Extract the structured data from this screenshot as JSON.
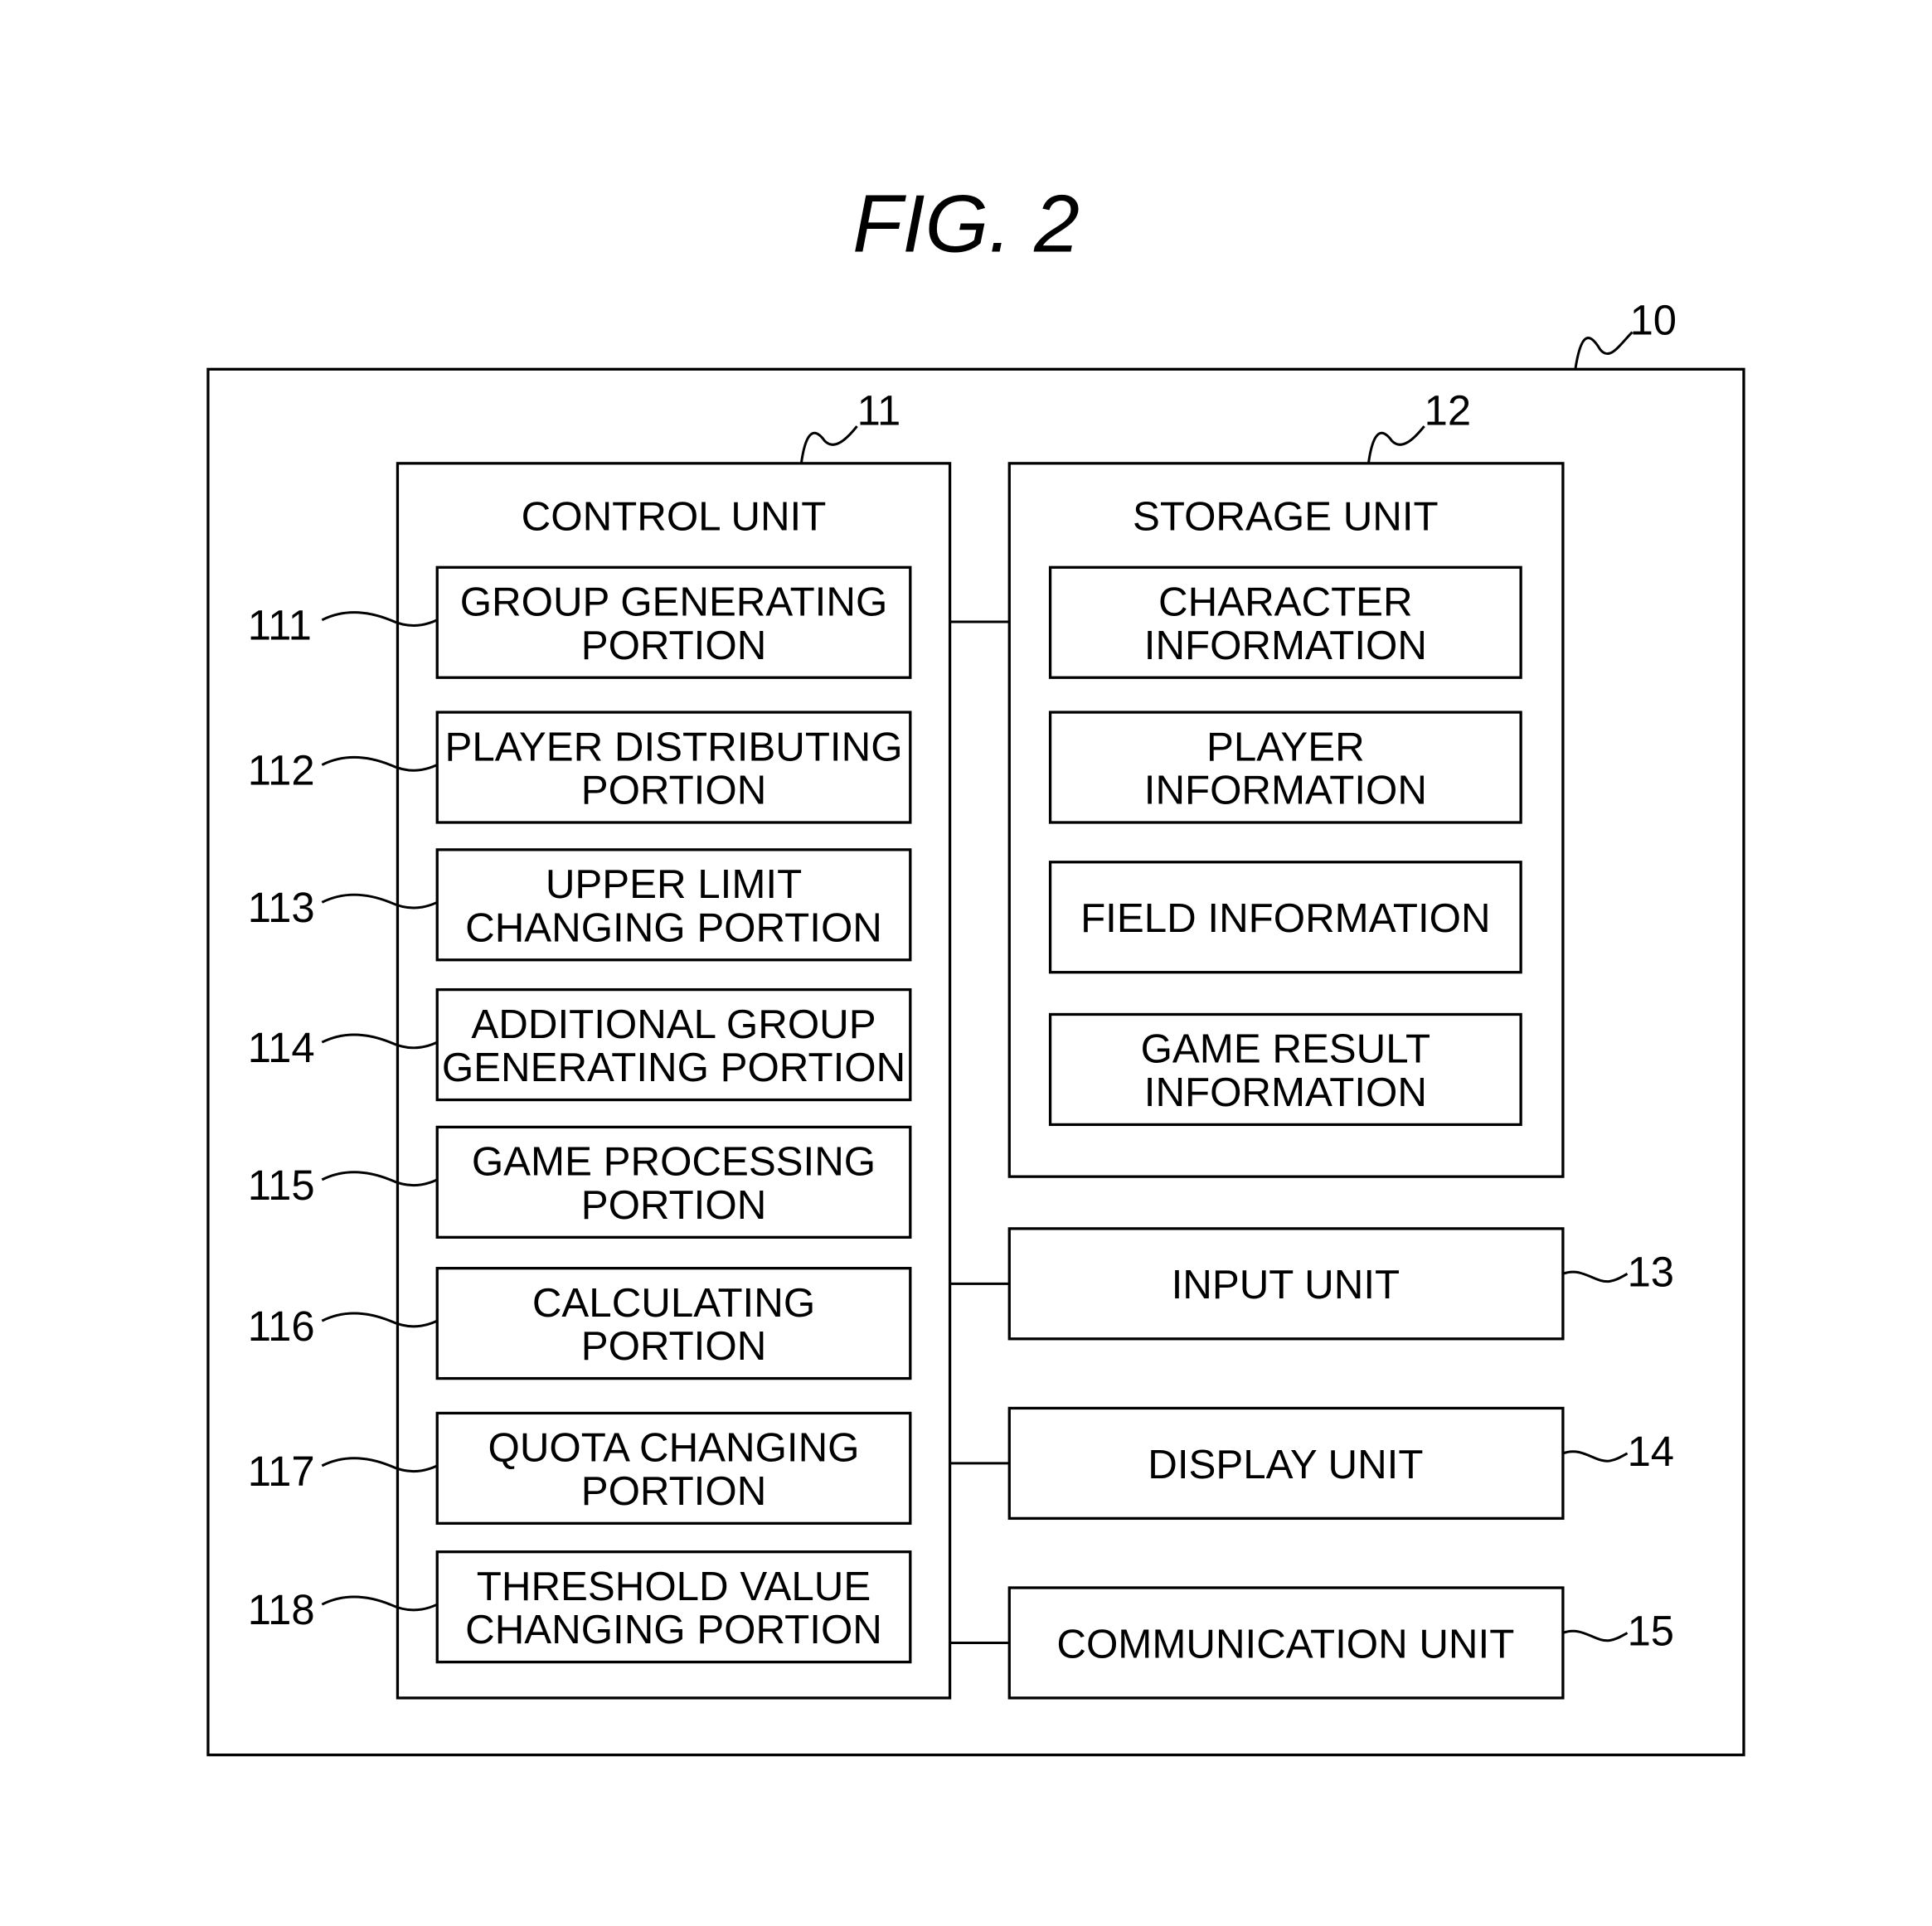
{
  "figure": {
    "title": "FIG. 2",
    "device_ref": "10"
  },
  "control_unit": {
    "ref": "11",
    "label": "CONTROL UNIT",
    "portions": [
      {
        "ref": "111",
        "lines": [
          "GROUP GENERATING",
          "PORTION"
        ]
      },
      {
        "ref": "112",
        "lines": [
          "PLAYER DISTRIBUTING",
          "PORTION"
        ]
      },
      {
        "ref": "113",
        "lines": [
          "UPPER LIMIT",
          "CHANGING PORTION"
        ]
      },
      {
        "ref": "114",
        "lines": [
          "ADDITIONAL GROUP",
          "GENERATING PORTION"
        ]
      },
      {
        "ref": "115",
        "lines": [
          "GAME PROCESSING",
          "PORTION"
        ]
      },
      {
        "ref": "116",
        "lines": [
          "CALCULATING",
          "PORTION"
        ]
      },
      {
        "ref": "117",
        "lines": [
          "QUOTA CHANGING",
          "PORTION"
        ]
      },
      {
        "ref": "118",
        "lines": [
          "THRESHOLD VALUE",
          "CHANGING PORTION"
        ]
      }
    ]
  },
  "storage_unit": {
    "ref": "12",
    "label": "STORAGE UNIT",
    "items": [
      {
        "lines": [
          "CHARACTER",
          "INFORMATION"
        ]
      },
      {
        "lines": [
          "PLAYER",
          "INFORMATION"
        ]
      },
      {
        "lines": [
          "FIELD INFORMATION"
        ]
      },
      {
        "lines": [
          "GAME RESULT",
          "INFORMATION"
        ]
      }
    ]
  },
  "other_units": [
    {
      "ref": "13",
      "label": "INPUT UNIT"
    },
    {
      "ref": "14",
      "label": "DISPLAY UNIT"
    },
    {
      "ref": "15",
      "label": "COMMUNICATION UNIT"
    }
  ]
}
